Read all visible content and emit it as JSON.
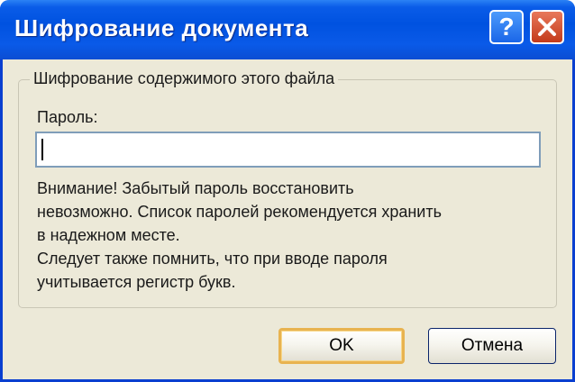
{
  "window": {
    "title": "Шифрование документа",
    "help_glyph": "?",
    "accent_titlebar": "#0052e0",
    "close_color": "#c33a1a"
  },
  "group": {
    "title": "Шифрование содержимого этого файла",
    "password_label": "Пароль:",
    "password_value": "",
    "warning_lines": [
      "Внимание! Забытый пароль восстановить",
      "невозможно. Список паролей рекомендуется хранить",
      "в надежном месте.",
      "Следует также помнить, что при вводе пароля",
      "учитывается регистр букв."
    ]
  },
  "buttons": {
    "ok": "OK",
    "cancel": "Отмена"
  },
  "icons": {
    "help": "help-icon",
    "close": "close-icon"
  }
}
